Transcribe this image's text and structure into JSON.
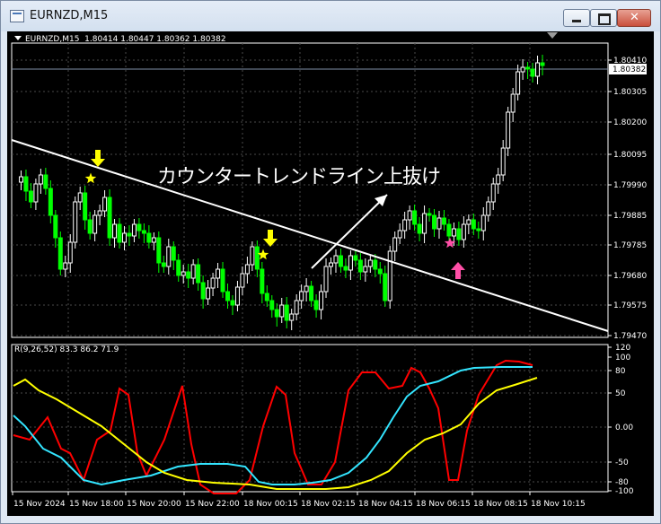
{
  "window": {
    "title": "EURNZD,M15"
  },
  "colors": {
    "bull": "#ffffff",
    "bear": "#00ff00",
    "grid": "#4a4a4a",
    "trendline": "#ffffff",
    "arrow_down": "#ffff00",
    "star_left": "#ffff00",
    "arrow_up": "#ff4fa7",
    "star_right": "#ff4fa7",
    "rci_red": "#ff0000",
    "rci_cyan": "#33e5ff",
    "rci_yellow": "#ffff00"
  },
  "chart": {
    "info": "EURNZD,M15  1.80414 1.80447 1.80362 1.80382",
    "price_axis": [
      "1.80410",
      "1.80305",
      "1.80200",
      "1.80095",
      "1.79990",
      "1.79885",
      "1.79785",
      "1.79680",
      "1.79575",
      "1.79470"
    ],
    "current_price": "1.80382",
    "annotation": "カウンタートレンドライン上抜け",
    "signals": {
      "down_arrow": "down-arrow",
      "up_arrow": "up-arrow",
      "star": "star"
    }
  },
  "indicator": {
    "label": "R(9,26,52) 83.3 86.2 71.9",
    "axis": [
      "120",
      "100",
      "80",
      "50",
      "0.00",
      "-50",
      "-80",
      "-100"
    ]
  },
  "time_axis": [
    "15 Nov 2024",
    "15 Nov 18:00",
    "15 Nov 20:00",
    "15 Nov 22:00",
    "18 Nov 00:15",
    "18 Nov 02:15",
    "18 Nov 04:15",
    "18 Nov 06:15",
    "18 Nov 08:15",
    "18 Nov 10:15"
  ]
}
